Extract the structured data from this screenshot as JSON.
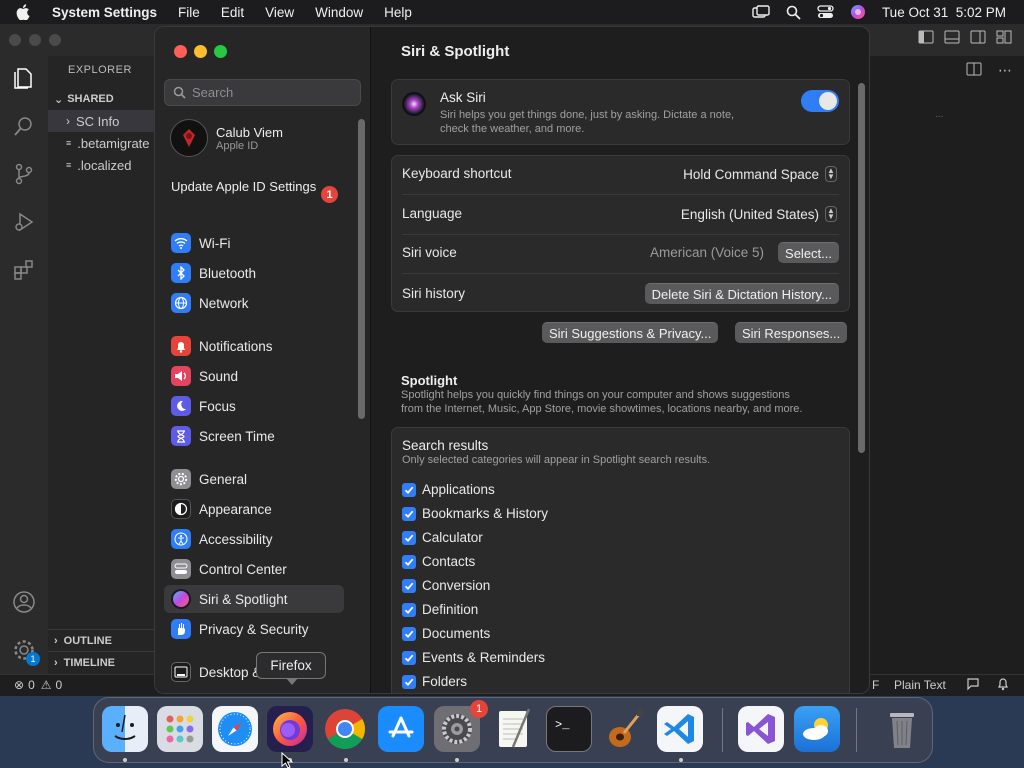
{
  "menubar": {
    "app_name": "System Settings",
    "items": [
      "File",
      "Edit",
      "View",
      "Window",
      "Help"
    ],
    "datetime": "Tue Oct 31  5:02 PM"
  },
  "vscode": {
    "explorer_title": "EXPLORER",
    "folder": "SHARED",
    "files": [
      "SC Info",
      ".betamigrate",
      ".localized"
    ],
    "outline": "OUTLINE",
    "timeline": "TIMELINE",
    "status_errors": "0",
    "status_warnings": "0",
    "status_lang": "Plain Text",
    "status_left_fragment": "F",
    "editor_fragment": "...",
    "settings_badge": "1"
  },
  "settings": {
    "search_placeholder": "Search",
    "user_name": "Calub Viem",
    "user_sub": "Apple ID",
    "update_label": "Update Apple ID Settings",
    "update_badge": "1",
    "nav": [
      {
        "label": "Wi-Fi",
        "color": "#2f7df7"
      },
      {
        "label": "Bluetooth",
        "color": "#2f7df7"
      },
      {
        "label": "Network",
        "color": "#2f7df7"
      },
      {
        "label": "Notifications",
        "color": "#e5443b"
      },
      {
        "label": "Sound",
        "color": "#e5445e"
      },
      {
        "label": "Focus",
        "color": "#5e5ce6"
      },
      {
        "label": "Screen Time",
        "color": "#5e5ce6"
      },
      {
        "label": "General",
        "color": "#8e8e93"
      },
      {
        "label": "Appearance",
        "color": "#1c1c1e"
      },
      {
        "label": "Accessibility",
        "color": "#2f7df7"
      },
      {
        "label": "Control Center",
        "color": "#8e8e93"
      },
      {
        "label": "Siri & Spotlight",
        "color": "#b04ad8"
      },
      {
        "label": "Privacy & Security",
        "color": "#2f7df7"
      },
      {
        "label": "Desktop & Dock",
        "color": "#1c1c1e"
      }
    ],
    "title": "Siri & Spotlight",
    "ask_siri": {
      "label": "Ask Siri",
      "desc1": "Siri helps you get things done, just by asking. Dictate a note,",
      "desc2": "check the weather, and more."
    },
    "keyboard_shortcut": {
      "label": "Keyboard shortcut",
      "value": "Hold Command Space"
    },
    "language": {
      "label": "Language",
      "value": "English (United States)"
    },
    "siri_voice": {
      "label": "Siri voice",
      "value": "American (Voice 5)",
      "button": "Select..."
    },
    "siri_history": {
      "label": "Siri history",
      "button": "Delete Siri & Dictation History..."
    },
    "suggestions_button": "Siri Suggestions & Privacy...",
    "responses_button": "Siri Responses...",
    "spotlight": {
      "title": "Spotlight",
      "desc1": "Spotlight helps you quickly find things on your computer and shows suggestions",
      "desc2": "from the Internet, Music, App Store, movie showtimes, locations nearby, and more."
    },
    "search_results": {
      "title": "Search results",
      "desc": "Only selected categories will appear in Spotlight search results.",
      "items": [
        "Applications",
        "Bookmarks & History",
        "Calculator",
        "Contacts",
        "Conversion",
        "Definition",
        "Documents",
        "Events & Reminders",
        "Folders"
      ]
    }
  },
  "dock": {
    "tooltip": "Firefox",
    "settings_badge": "1"
  }
}
